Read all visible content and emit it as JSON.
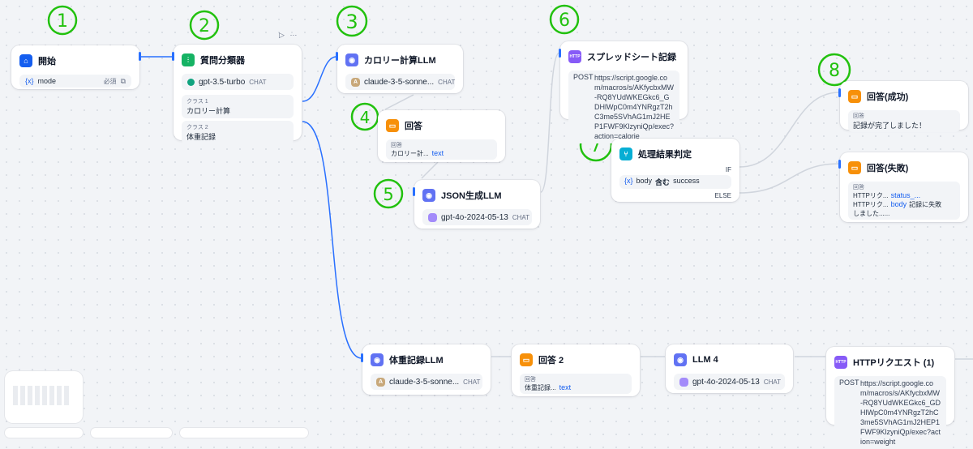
{
  "annotations": [
    "1",
    "2",
    "3",
    "4",
    "5",
    "6",
    "7",
    "8"
  ],
  "start": {
    "title": "開始",
    "var_icon": "{x}",
    "var": "mode",
    "required": "必須"
  },
  "classifier": {
    "title": "質問分類器",
    "model": "gpt-3.5-turbo",
    "mode": "CHAT",
    "class1_label": "クラス 1",
    "class1_value": "カロリー計算",
    "class2_label": "クラス 2",
    "class2_value": "体重記録"
  },
  "calorie_llm": {
    "title": "カロリー計算LLM",
    "model": "claude-3-5-sonne...",
    "mode": "CHAT"
  },
  "answer1": {
    "title": "回答",
    "label": "回答",
    "chip": "カロリー計...",
    "var": "text"
  },
  "json_llm": {
    "title": "JSON生成LLM",
    "model": "gpt-4o-2024-05-13",
    "mode": "CHAT"
  },
  "spreadsheet": {
    "title": "スプレッドシート記録",
    "method": "POST",
    "url": "https://script.google.com/macros/s/AKfycbxMW-RQ8YUdWKEGkc6_GDHlWpC0m4YNRgzT2hC3me5SVhAG1mJ2HEP1FWF9KlzyniQp/exec?action=calorie"
  },
  "condition": {
    "title": "処理結果判定",
    "if": "IF",
    "else": "ELSE",
    "var": "body",
    "op": "含む",
    "value": "success"
  },
  "answer_success": {
    "title": "回答(成功)",
    "label": "回答",
    "text": "記録が完了しました！"
  },
  "answer_fail": {
    "title": "回答(失敗)",
    "label": "回答",
    "chip1": "HTTPリク...",
    "var1": "status_...",
    "chip2": "HTTPリク...",
    "var2": "body",
    "text1": "記録に失敗",
    "text2": "しました......"
  },
  "weight_llm": {
    "title": "体重記録LLM",
    "model": "claude-3-5-sonne...",
    "mode": "CHAT"
  },
  "answer2": {
    "title": "回答 2",
    "label": "回答",
    "chip": "体重記録...",
    "var": "text"
  },
  "llm4": {
    "title": "LLM 4",
    "model": "gpt-4o-2024-05-13",
    "mode": "CHAT"
  },
  "http": {
    "title": "HTTPリクエスト (1)",
    "method": "POST",
    "url": "https://script.google.com/macros/s/AKfycbxMW-RQ8YUdWKEGkc6_GDHlWpC0m4YNRgzT2hC3me5SVhAG1mJ2HEP1FWF9KlzyniQp/exec?action=weight"
  },
  "toolbar": {
    "run_icon": "▷",
    "more_icon": "···"
  },
  "colors": {
    "edge": "#2970ff",
    "edge_gray": "#d0d5dd",
    "annotation": "#22c10e",
    "start_icon": "#155eef",
    "classifier_icon": "#16b364",
    "llm_icon": "#6172f3",
    "answer_icon": "#f79009",
    "http_icon": "#875bf7",
    "if_icon": "#06aed4"
  }
}
